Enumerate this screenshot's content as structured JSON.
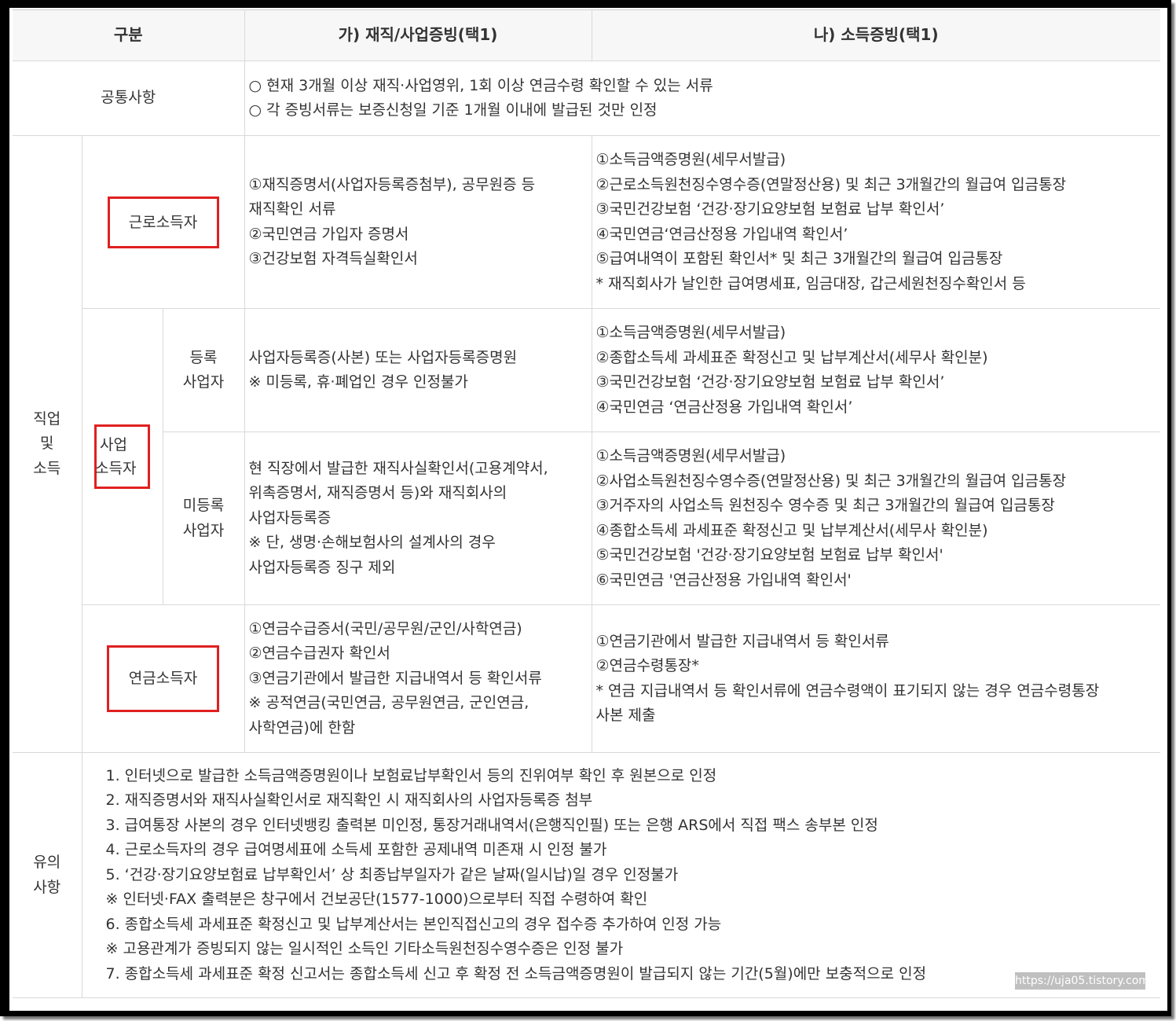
{
  "header": {
    "col_category": "구분",
    "col_a": "가) 재직/사업증빙(택1)",
    "col_b": "나) 소득증빙(택1)"
  },
  "common": {
    "label": "공통사항",
    "lines": [
      "○ 현재 3개월 이상 재직·사업영위, 1회 이상 연금수령 확인할 수 있는 서류",
      "○ 각 증빙서류는 보증신청일 기준 1개월 이내에 발급된 것만 인정"
    ]
  },
  "job": {
    "group_label": [
      "직업",
      "및",
      "소득"
    ],
    "employee": {
      "label": "근로소득자",
      "a": [
        "①재직증명서(사업자등록증첨부), 공무원증 등",
        "재직확인 서류",
        "②국민연금 가입자 증명서",
        "③건강보험 자격득실확인서"
      ],
      "b": [
        "①소득금액증명원(세무서발급)",
        "②근로소득원천징수영수증(연말정산용) 및 최근 3개월간의 월급여 입금통장",
        "③국민건강보험 ‘건강·장기요양보험 보험료 납부 확인서’",
        "④국민연금‘연금산정용 가입내역 확인서’",
        "⑤급여내역이 포함된 확인서* 및 최근 3개월간의 월급여 입금통장",
        "* 재직회사가 날인한 급여명세표, 임금대장, 갑근세원천징수확인서 등"
      ]
    },
    "business": {
      "label": [
        "사업",
        "소득자"
      ],
      "registered": {
        "label": [
          "등록",
          "사업자"
        ],
        "a": [
          "사업자등록증(사본) 또는 사업자등록증명원",
          "※ 미등록, 휴·폐업인 경우 인정불가"
        ],
        "b": [
          "①소득금액증명원(세무서발급)",
          "②종합소득세 과세표준 확정신고 및 납부계산서(세무사 확인분)",
          "③국민건강보험 ‘건강·장기요양보험 보험료 납부 확인서’",
          "④국민연금 ‘연금산정용 가입내역 확인서’"
        ]
      },
      "unregistered": {
        "label": [
          "미등록",
          "사업자"
        ],
        "a": [
          "현 직장에서 발급한 재직사실확인서(고용계약서,",
          "위촉증명서, 재직증명서 등)와 재직회사의",
          "사업자등록증",
          "※ 단, 생명·손해보험사의 설계사의 경우",
          "사업자등록증 징구 제외"
        ],
        "b": [
          "①소득금액증명원(세무서발급)",
          "②사업소득원천징수영수증(연말정산용) 및 최근 3개월간의 월급여 입금통장",
          "③거주자의 사업소득 원천징수 영수증 및 최근 3개월간의 월급여 입금통장",
          "④종합소득세 과세표준 확정신고 및 납부계산서(세무사 확인분)",
          "⑤국민건강보험 '건강·장기요양보험 보험료 납부 확인서'",
          "⑥국민연금 '연금산정용 가입내역 확인서'"
        ]
      }
    },
    "pension": {
      "label": "연금소득자",
      "a": [
        "①연금수급증서(국민/공무원/군인/사학연금)",
        "②연금수급권자 확인서",
        "③연금기관에서 발급한 지급내역서 등 확인서류",
        "※ 공적연금(국민연금, 공무원연금, 군인연금,",
        "사학연금)에 한함"
      ],
      "b": [
        "①연금기관에서 발급한 지급내역서 등 확인서류",
        "②연금수령통장*",
        "* 연금 지급내역서 등 확인서류에 연금수령액이 표기되지 않는 경우 연금수령통장",
        "사본 제출"
      ]
    }
  },
  "notes": {
    "label": [
      "유의",
      "사항"
    ],
    "lines": [
      "1. 인터넷으로 발급한 소득금액증명원이나 보험료납부확인서 등의 진위여부 확인 후 원본으로 인정",
      "2. 재직증명서와 재직사실확인서로 재직확인 시 재직회사의 사업자등록증 첨부",
      "3. 급여통장 사본의 경우 인터넷뱅킹 출력본 미인정, 통장거래내역서(은행직인필) 또는 은행 ARS에서 직접 팩스 송부본 인정",
      "4. 근로소득자의 경우 급여명세표에 소득세 포함한 공제내역 미존재 시 인정 불가",
      "5. ‘건강·장기요양보험료 납부확인서’ 상 최종납부일자가 같은 날짜(일시납)일 경우 인정불가",
      "※ 인터넷·FAX 출력분은 창구에서 건보공단(1577-1000)으로부터 직접 수령하여 확인",
      "6. 종합소득세 과세표준 확정신고 및 납부계산서는 본인직접신고의 경우 접수증 추가하여 인정 가능",
      "※ 고용관계가 증빙되지 않는 일시적인 소득인 기타소득원천징수영수증은 인정 불가",
      "7. 종합소득세 과세표준 확정 신고서는 종합소득세 신고 후 확정 전 소득금액증명원이 발급되지 않는 기간(5월)에만 보충적으로 인정"
    ]
  },
  "watermark": "https://uja05.tistory.com",
  "colors": {
    "highlight_box": "#e02020",
    "header_bg": "#f7f7f7",
    "border": "#d9d9d9"
  }
}
